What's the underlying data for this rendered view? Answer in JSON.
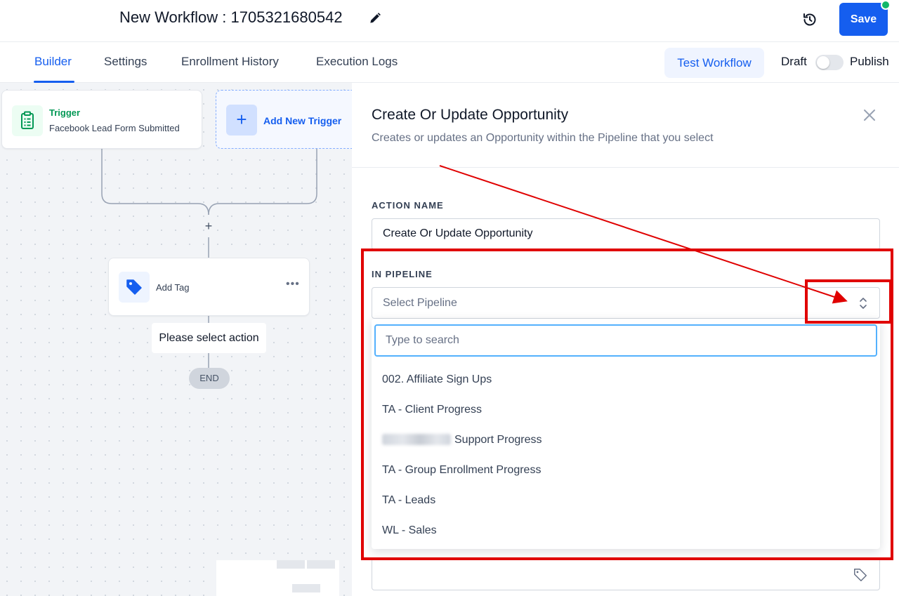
{
  "header": {
    "workflow_title": "New Workflow : 1705321680542",
    "save_label": "Save",
    "icons": {
      "edit": "pencil-icon",
      "history": "history-clock-icon"
    }
  },
  "tabs": {
    "items": [
      {
        "label": "Builder",
        "active": true
      },
      {
        "label": "Settings",
        "active": false
      },
      {
        "label": "Enrollment History",
        "active": false
      },
      {
        "label": "Execution Logs",
        "active": false
      }
    ],
    "test_workflow_label": "Test Workflow",
    "draft_label": "Draft",
    "publish_label": "Publish",
    "publish_toggle_on": false
  },
  "canvas": {
    "trigger": {
      "title": "Trigger",
      "subtitle": "Facebook Lead Form Submitted",
      "icon": "clipboard-icon"
    },
    "add_trigger_label": "Add New Trigger",
    "action": {
      "label": "Add Tag",
      "icon": "tag-icon"
    },
    "select_action_label": "Please select action",
    "end_label": "END"
  },
  "panel": {
    "title": "Create Or Update Opportunity",
    "subtitle": "Creates or updates an Opportunity within the Pipeline that you select",
    "action_name_label": "ACTION NAME",
    "action_name_value": "Create Or Update Opportunity",
    "pipeline_label": "IN PIPELINE",
    "pipeline_placeholder": "Select Pipeline",
    "search_placeholder": "Type to search",
    "pipeline_options": [
      "002. Affiliate Sign Ups",
      "TA - Client Progress",
      "Support Progress",
      "TA - Group Enrollment Progress",
      "TA - Leads",
      "WL - Sales"
    ]
  },
  "colors": {
    "primary": "#155eef",
    "trigger_green": "#039855",
    "annotation_red": "#e00000",
    "status_dot": "#12b76a"
  }
}
